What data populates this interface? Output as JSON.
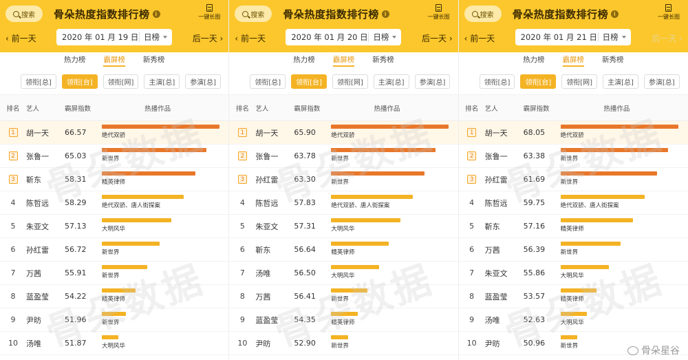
{
  "app_title": "骨朵热度指数排行榜",
  "search_label": "搜索",
  "long_image_label": "一键长图",
  "prev_label": "前一天",
  "next_label": "后一天",
  "type_label": "日榜",
  "tabs": [
    "热力榜",
    "霸屏榜",
    "新秀榜"
  ],
  "active_tab": 1,
  "filters": [
    "领衔[总]",
    "领衔[台]",
    "领衔[网]",
    "主演[总]",
    "参演[总]"
  ],
  "active_filter": 1,
  "table_headers": {
    "rank": "排名",
    "artist": "艺人",
    "score": "霸屏指数",
    "works": "热播作品"
  },
  "watermark_text": "骨朵数据",
  "corner_text": "骨朵星谷",
  "colors": {
    "bar_top3": "#e8772a",
    "bar_rest": "#f4b324",
    "accent": "#fcc72c"
  },
  "panels": [
    {
      "date": "2020 年 01 月 19 日",
      "next_dim": false,
      "rows": [
        {
          "rank": "1",
          "name": "胡一天",
          "score": "66.57",
          "works": "绝代双骄",
          "level": 0.98
        },
        {
          "rank": "2",
          "name": "张鲁一",
          "score": "65.03",
          "works": "新世界",
          "level": 0.87
        },
        {
          "rank": "3",
          "name": "靳东",
          "score": "58.31",
          "works": "精英律师",
          "level": 0.78
        },
        {
          "rank": "4",
          "name": "陈哲远",
          "score": "58.29",
          "works": "绝代双骄、唐人街探案",
          "level": 0.68
        },
        {
          "rank": "5",
          "name": "朱亚文",
          "score": "57.13",
          "works": "大明风华",
          "level": 0.58
        },
        {
          "rank": "6",
          "name": "孙红雷",
          "score": "56.72",
          "works": "新世界",
          "level": 0.48
        },
        {
          "rank": "7",
          "name": "万茜",
          "score": "55.91",
          "works": "新世界",
          "level": 0.38
        },
        {
          "rank": "8",
          "name": "蓝盈莹",
          "score": "54.22",
          "works": "精英律师",
          "level": 0.28
        },
        {
          "rank": "9",
          "name": "尹昉",
          "score": "51.96",
          "works": "新世界",
          "level": 0.2
        },
        {
          "rank": "10",
          "name": "汤唯",
          "score": "51.87",
          "works": "大明风华",
          "level": 0.14
        }
      ]
    },
    {
      "date": "2020 年 01 月 20 日",
      "next_dim": false,
      "rows": [
        {
          "rank": "1",
          "name": "胡一天",
          "score": "65.90",
          "works": "绝代双骄",
          "level": 0.98
        },
        {
          "rank": "2",
          "name": "张鲁一",
          "score": "63.78",
          "works": "新世界",
          "level": 0.87
        },
        {
          "rank": "3",
          "name": "孙红雷",
          "score": "63.30",
          "works": "新世界",
          "level": 0.78
        },
        {
          "rank": "4",
          "name": "陈哲远",
          "score": "57.83",
          "works": "绝代双骄、唐人街探案",
          "level": 0.68
        },
        {
          "rank": "5",
          "name": "朱亚文",
          "score": "57.31",
          "works": "大明风华",
          "level": 0.58
        },
        {
          "rank": "6",
          "name": "靳东",
          "score": "56.64",
          "works": "精英律师",
          "level": 0.48
        },
        {
          "rank": "7",
          "name": "汤唯",
          "score": "56.50",
          "works": "大明风华",
          "level": 0.4
        },
        {
          "rank": "8",
          "name": "万茜",
          "score": "56.41",
          "works": "新世界",
          "level": 0.3
        },
        {
          "rank": "9",
          "name": "蓝盈莹",
          "score": "54.35",
          "works": "精英律师",
          "level": 0.22
        },
        {
          "rank": "10",
          "name": "尹昉",
          "score": "52.90",
          "works": "新世界",
          "level": 0.14
        }
      ]
    },
    {
      "date": "2020 年 01 月 21 日",
      "next_dim": true,
      "rows": [
        {
          "rank": "1",
          "name": "胡一天",
          "score": "68.05",
          "works": "绝代双骄",
          "level": 0.98
        },
        {
          "rank": "2",
          "name": "张鲁一",
          "score": "63.38",
          "works": "新世界",
          "level": 0.89
        },
        {
          "rank": "3",
          "name": "孙红雷",
          "score": "61.69",
          "works": "新世界",
          "level": 0.8
        },
        {
          "rank": "4",
          "name": "陈哲远",
          "score": "59.75",
          "works": "绝代双骄、唐人街探案",
          "level": 0.7
        },
        {
          "rank": "5",
          "name": "靳东",
          "score": "57.16",
          "works": "精英律师",
          "level": 0.6
        },
        {
          "rank": "6",
          "name": "万茜",
          "score": "56.39",
          "works": "新世界",
          "level": 0.5
        },
        {
          "rank": "7",
          "name": "朱亚文",
          "score": "55.86",
          "works": "大明风华",
          "level": 0.4
        },
        {
          "rank": "8",
          "name": "蓝盈莹",
          "score": "53.57",
          "works": "精英律师",
          "level": 0.3
        },
        {
          "rank": "9",
          "name": "汤唯",
          "score": "52.63",
          "works": "大明风华",
          "level": 0.22
        },
        {
          "rank": "10",
          "name": "尹昉",
          "score": "50.96",
          "works": "新世界",
          "level": 0.14
        }
      ]
    }
  ]
}
